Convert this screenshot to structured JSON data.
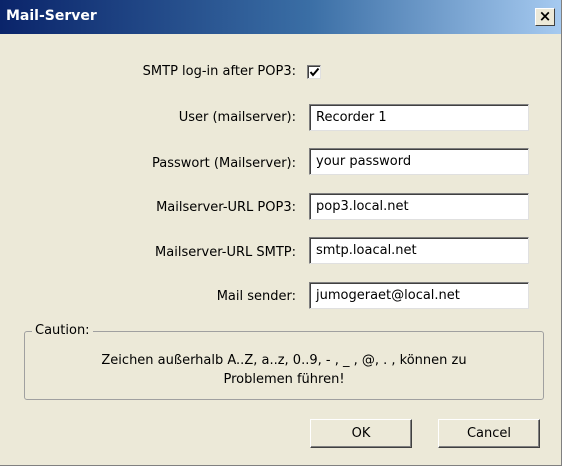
{
  "window": {
    "title": "Mail-Server",
    "close_glyph": "×"
  },
  "form": {
    "smtp_login": {
      "label": "SMTP log-in after POP3:",
      "checked": true
    },
    "user": {
      "label": "User (mailserver):",
      "value": "Recorder 1"
    },
    "password": {
      "label": "Passwort (Mailserver):",
      "value": "your password"
    },
    "pop3_url": {
      "label": "Mailserver-URL POP3:",
      "value": "pop3.local.net"
    },
    "smtp_url": {
      "label": "Mailserver-URL SMTP:",
      "value": "smtp.loacal.net"
    },
    "sender": {
      "label": "Mail sender:",
      "value": "jumogeraet@local.net"
    }
  },
  "caution": {
    "title": "Caution:",
    "line1": "Zeichen außerhalb A..Z, a..z, 0..9, - , _ , @, . , können zu",
    "line2": "Problemen führen!"
  },
  "buttons": {
    "ok": "OK",
    "cancel": "Cancel"
  },
  "colors": {
    "titlebar_start": "#0a246a",
    "titlebar_end": "#a6caf0",
    "dialog_bg": "#ece9d8"
  }
}
